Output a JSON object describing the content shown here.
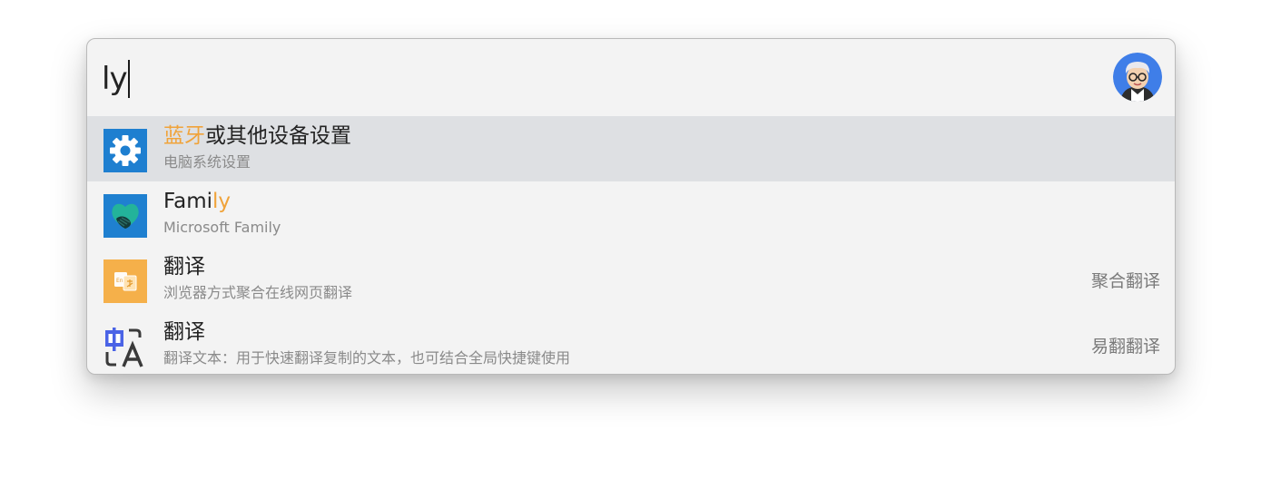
{
  "search": {
    "query": "ly"
  },
  "user": {
    "avatar": "cartoon-user-avatar"
  },
  "results": [
    {
      "title_highlight": "蓝牙",
      "title_rest": "或其他设备设置",
      "subtitle": "电脑系统设置",
      "right_label": "",
      "icon": "gear-icon",
      "icon_bg": "#1e7fd0",
      "selected": true
    },
    {
      "title_prefix": "Fami",
      "title_highlight": "ly",
      "subtitle": "Microsoft Family",
      "right_label": "",
      "icon": "family-heart-icon",
      "icon_bg": "#1f80d0",
      "selected": false
    },
    {
      "title": "翻译",
      "subtitle": "浏览器方式聚合在线网页翻译",
      "right_label": "聚合翻译",
      "icon": "translate-doc-icon",
      "icon_bg": "#f5b04a",
      "selected": false
    },
    {
      "title": "翻译",
      "subtitle": "翻译文本：用于快速翻译复制的文本，也可结合全局快捷键使用",
      "right_label": "易翻翻译",
      "icon": "translate-zh-a-icon",
      "icon_bg": "#ffffff",
      "selected": false
    }
  ],
  "colors": {
    "highlight": "#f0a33a",
    "selected_row": "#dee0e3",
    "panel": "#f3f3f3"
  }
}
